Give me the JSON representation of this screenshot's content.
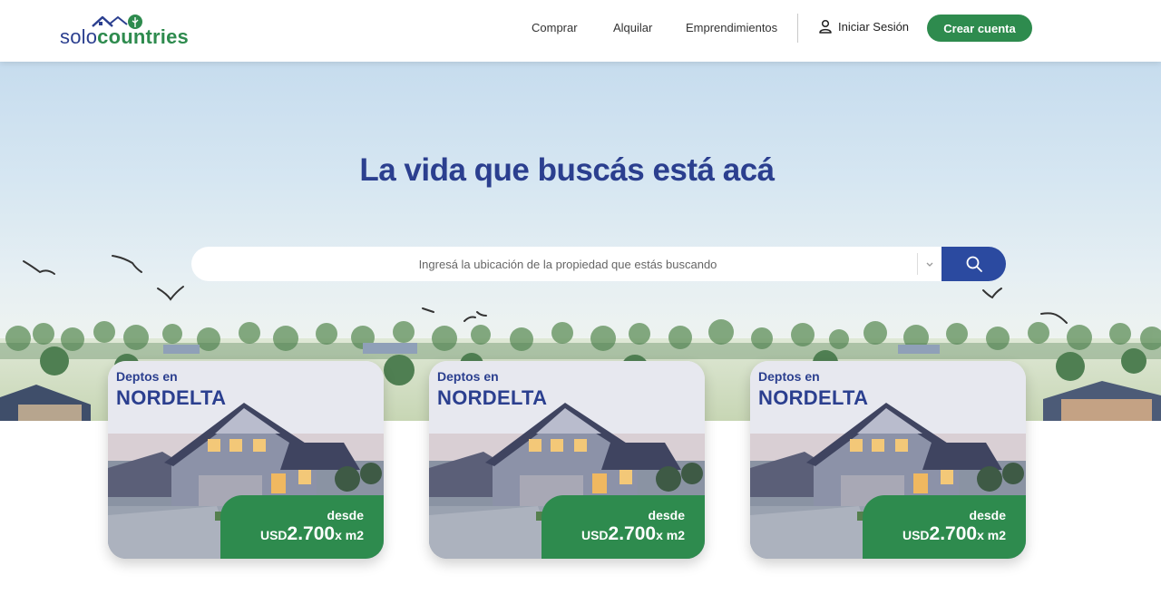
{
  "brand": {
    "logo_part1": "solo",
    "logo_part2": "countries",
    "blue": "#2b3f8f",
    "green": "#2e8b4e"
  },
  "nav": {
    "items": [
      {
        "label": "Comprar"
      },
      {
        "label": "Alquilar"
      },
      {
        "label": "Emprendimientos"
      }
    ],
    "login_label": "Iniciar Sesión",
    "login_icon": "user-icon",
    "signup_label": "Crear cuenta"
  },
  "hero": {
    "title": "La vida que buscás está acá",
    "search_placeholder": "Ingresá la ubicación de la propiedad que estás buscando",
    "search_icon": "search-icon",
    "dropdown_icon": "chevron-down-icon"
  },
  "cards": [
    {
      "pre": "Deptos en",
      "title": "NORDELTA",
      "from": "desde",
      "currency": "USD",
      "price": "2.700",
      "unit": "x m2"
    },
    {
      "pre": "Deptos en",
      "title": "NORDELTA",
      "from": "desde",
      "currency": "USD",
      "price": "2.700",
      "unit": "x m2"
    },
    {
      "pre": "Deptos en",
      "title": "NORDELTA",
      "from": "desde",
      "currency": "USD",
      "price": "2.700",
      "unit": "x m2"
    }
  ]
}
